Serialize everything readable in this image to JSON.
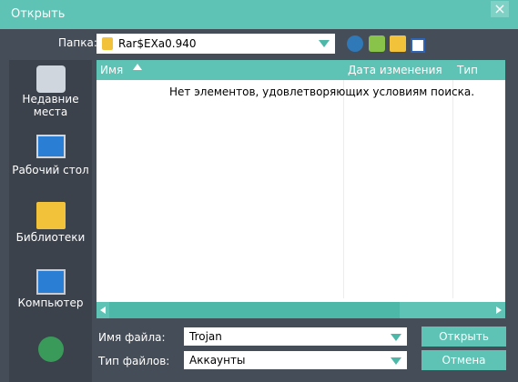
{
  "window": {
    "title": "Открыть",
    "close_glyph": "×"
  },
  "location": {
    "label": "Папка:",
    "current_folder": "Rar$EXa0.940"
  },
  "places": [
    {
      "label_line1": "Недавние",
      "label_line2": "места",
      "icon": "recent-places-icon"
    },
    {
      "label_line1": "Рабочий стол",
      "icon": "desktop-icon"
    },
    {
      "label_line1": "Библиотеки",
      "icon": "libraries-icon"
    },
    {
      "label_line1": "Компьютер",
      "icon": "computer-icon"
    },
    {
      "label_line1": "",
      "icon": "network-icon"
    }
  ],
  "filelist": {
    "columns": [
      "Имя",
      "Дата изменения",
      "Тип"
    ],
    "empty_message": "Нет элементов, удовлетворяющих условиям поиска."
  },
  "filename": {
    "label": "Имя файла:",
    "value": "Trojan"
  },
  "filetype": {
    "label": "Тип файлов:",
    "value": "Аккаунты"
  },
  "buttons": {
    "open": "Открыть",
    "cancel": "Отмена"
  }
}
